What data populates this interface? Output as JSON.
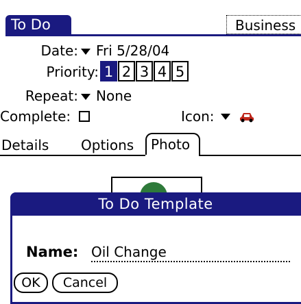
{
  "header": {
    "title": "To Do",
    "category": "Business"
  },
  "fields": {
    "date_label": "Date:",
    "date_value": "Fri 5/28/04",
    "priority_label": "Priority:",
    "priority_options": [
      "1",
      "2",
      "3",
      "4",
      "5"
    ],
    "priority_selected": "1",
    "repeat_label": "Repeat:",
    "repeat_value": "None",
    "complete_label": "Complete:",
    "complete_checked": false,
    "icon_label": "Icon:",
    "icon_name": "car-icon"
  },
  "tabs": [
    "Details",
    "Options",
    "Photo"
  ],
  "active_tab": "Photo",
  "dialog": {
    "title": "To Do Template",
    "name_label": "Name:",
    "name_value": "Oil Change",
    "ok_label": "OK",
    "cancel_label": "Cancel"
  },
  "colors": {
    "accent": "#1a1a80",
    "icon_car": "#c0281c",
    "photo_green": "#2e7a3a"
  }
}
